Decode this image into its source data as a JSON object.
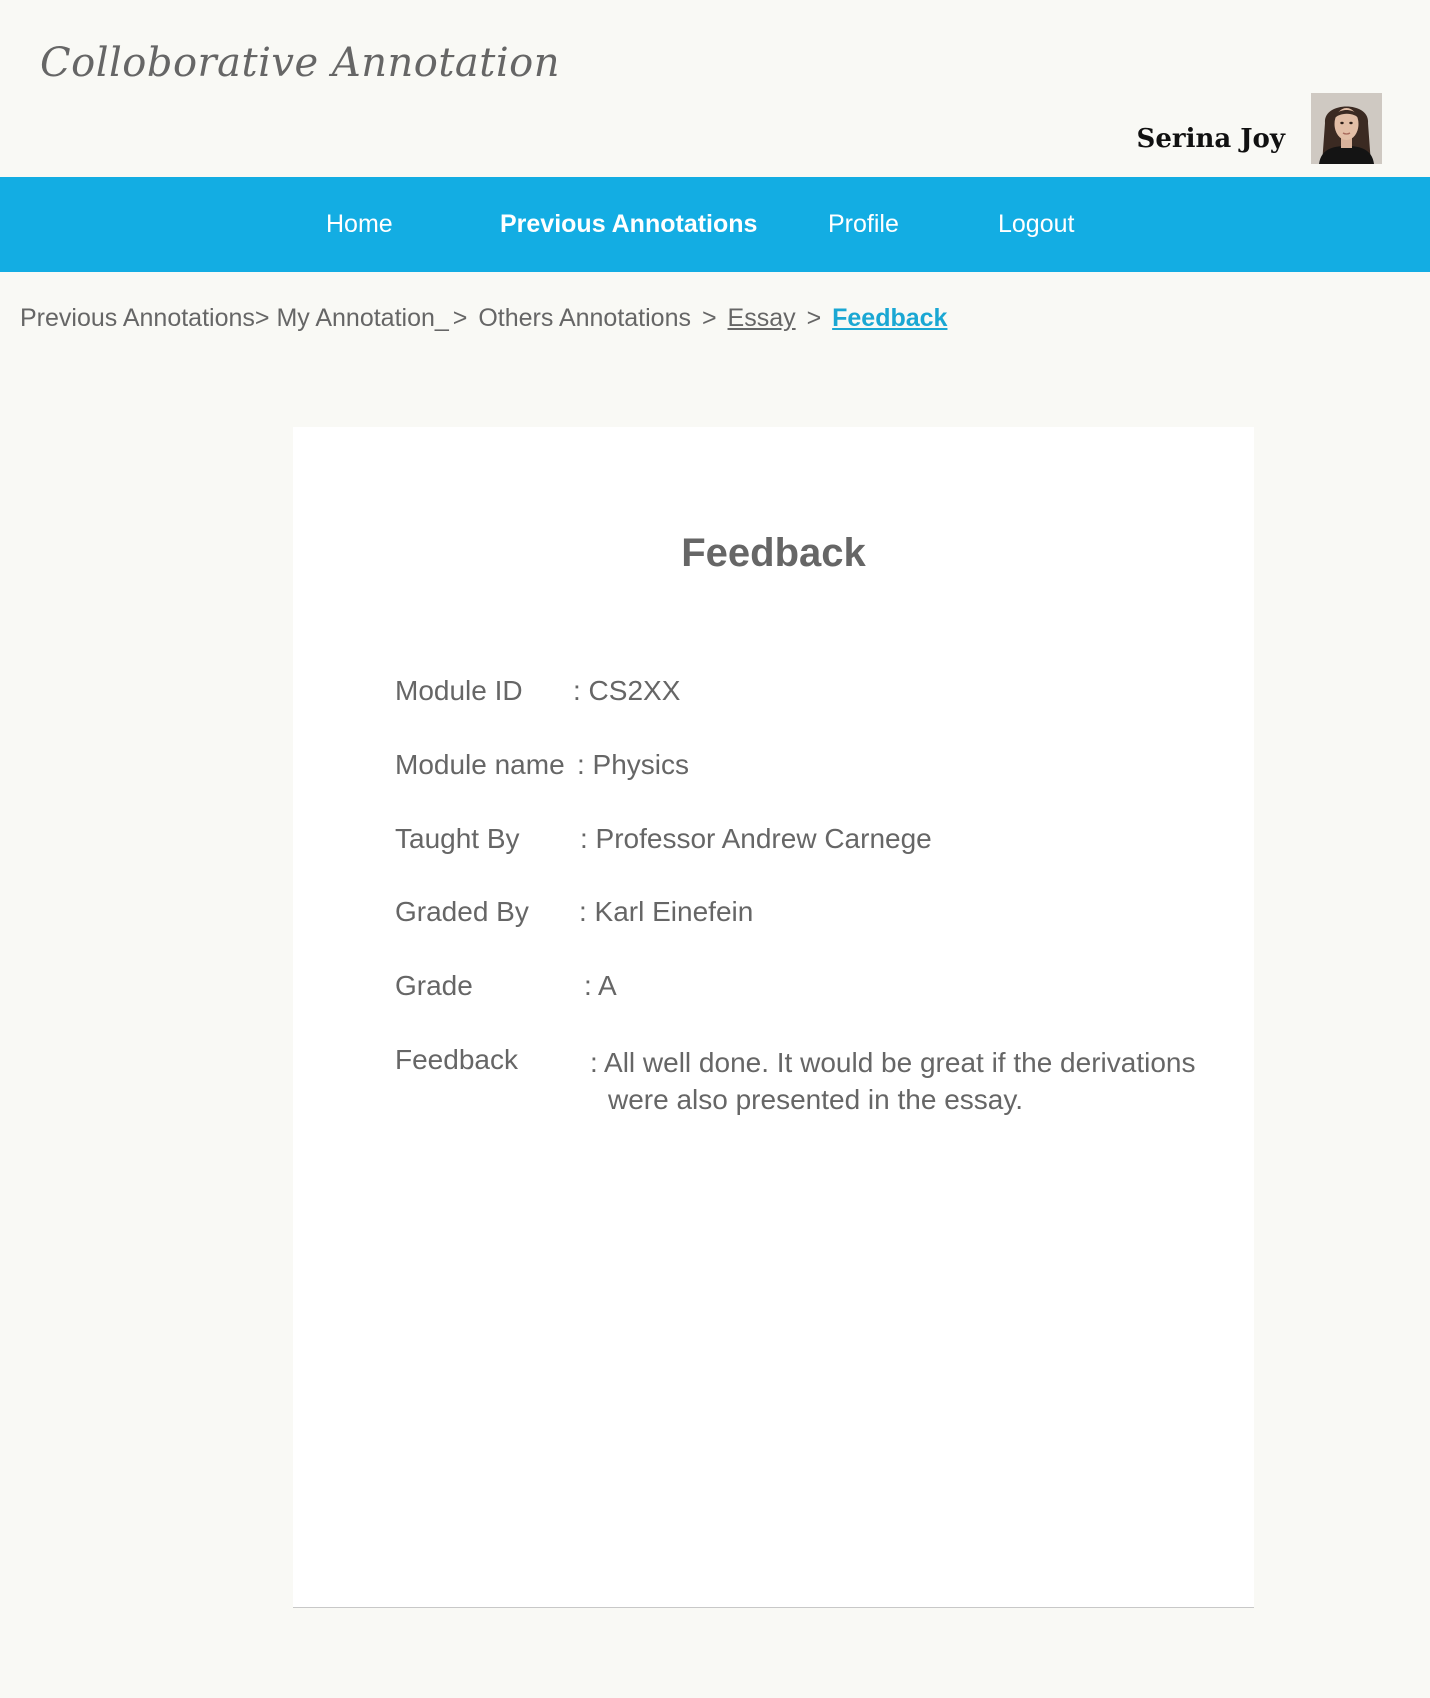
{
  "app": {
    "title": "Colloborative Annotation"
  },
  "user": {
    "name": "Serina Joy"
  },
  "nav": {
    "items": [
      {
        "label": "Home"
      },
      {
        "label": "Previous Annotations"
      },
      {
        "label": "Profile"
      },
      {
        "label": "Logout"
      }
    ],
    "active_index": 1
  },
  "breadcrumb": {
    "items": [
      {
        "label": "Previous Annotations"
      },
      {
        "label": "My Annotation_"
      },
      {
        "label": "Others Annotations"
      },
      {
        "label": "Essay"
      },
      {
        "label": "Feedback"
      }
    ],
    "separator": ">"
  },
  "card": {
    "title": "Feedback",
    "fields": {
      "module_id": {
        "label": "Module ID",
        "value": ": CS2XX"
      },
      "module_name": {
        "label": "Module name",
        "value": ": Physics"
      },
      "taught_by": {
        "label": "Taught  By",
        "value": ": Professor Andrew Carnege"
      },
      "graded_by": {
        "label": "Graded By",
        "value": ": Karl Einefein"
      },
      "grade": {
        "label": "Grade",
        "value": ": A"
      },
      "feedback": {
        "label": "Feedback",
        "value": ": All well done. It would be great if the derivations were also presented in the essay."
      }
    }
  },
  "colors": {
    "nav_background": "#13ade3",
    "page_background": "#f9f9f5",
    "text": "#666666",
    "breadcrumb_active": "#1aa7d3"
  }
}
